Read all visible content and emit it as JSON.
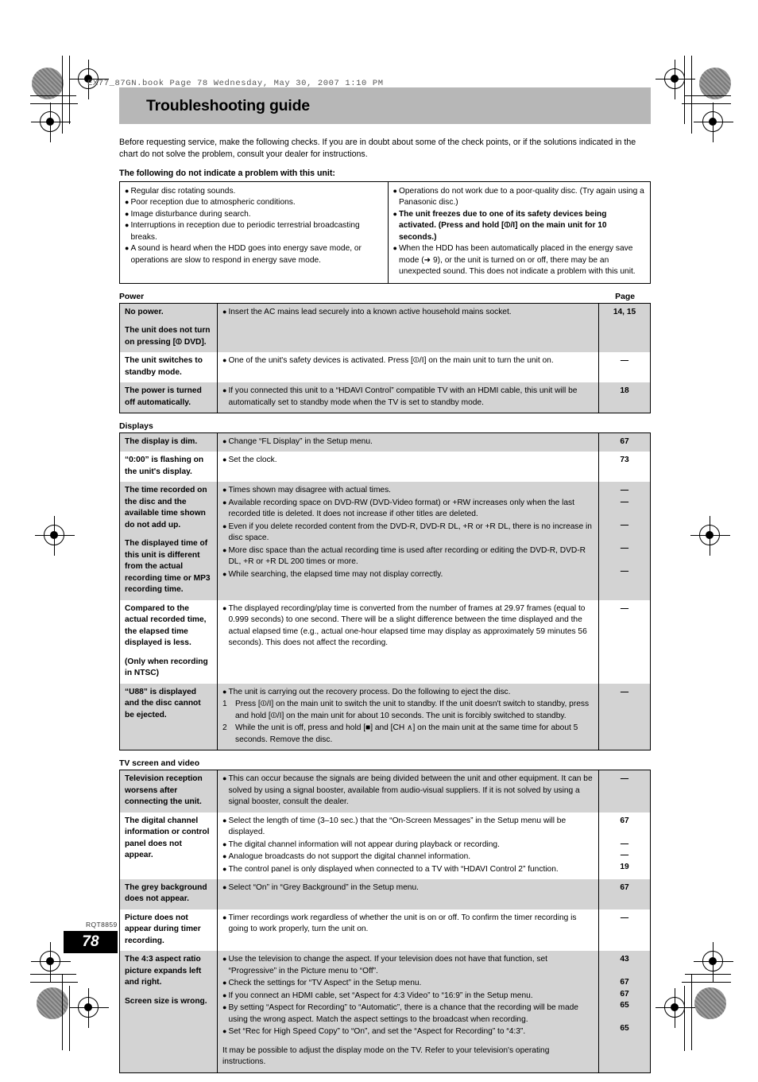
{
  "book_line": "EX77_87GN.book  Page 78  Wednesday, May 30, 2007  1:10 PM",
  "title": "Troubleshooting guide",
  "intro": "Before requesting service, make the following checks. If you are in doubt about some of the check points, or if the solutions indicated in the chart do not solve the problem, consult your dealer for instructions.",
  "intro_bold": "The following do not indicate a problem with this unit:",
  "notebox": {
    "left": [
      "Regular disc rotating sounds.",
      "Poor reception due to atmospheric conditions.",
      "Image disturbance during search.",
      "Interruptions in reception due to periodic terrestrial broadcasting breaks.",
      "A sound is heard when the HDD goes into energy save mode, or operations are slow to respond in energy save mode."
    ],
    "right": [
      {
        "bold": false,
        "text": "Operations do not work due to a poor-quality disc. (Try again using a Panasonic disc.)"
      },
      {
        "bold": true,
        "text": "The unit freezes due to one of its safety devices being activated. (Press and hold [⏼/I] on the main unit for 10 seconds.)"
      },
      {
        "bold": false,
        "text": "When the HDD has been automatically placed in the energy save mode (➜ 9), or the unit is turned on or off, there may be an unexpected sound. This does not indicate a problem with this unit."
      }
    ]
  },
  "page_label": "Page",
  "sections": [
    {
      "name": "Power",
      "rows": [
        {
          "shade": true,
          "symptom": [
            "No power.",
            "The unit does not turn on pressing [⏼ DVD]."
          ],
          "bullets": [
            "Insert the AC mains lead securely into a known active household mains socket."
          ],
          "pages": [
            "14, 15"
          ]
        },
        {
          "shade": false,
          "symptom": [
            "The unit switches to standby mode."
          ],
          "bullets": [
            "One of the unit's safety devices is activated. Press [⏼/I] on the main unit to turn the unit on."
          ],
          "pages": [
            "—"
          ]
        },
        {
          "shade": true,
          "symptom": [
            "The power is turned off automatically."
          ],
          "bullets": [
            "If you connected this unit to a “HDAVI Control” compatible TV with an HDMI cable, this unit will be automatically set to standby mode when the TV is set to standby mode."
          ],
          "pages": [
            "18"
          ]
        }
      ]
    },
    {
      "name": "Displays",
      "rows": [
        {
          "shade": true,
          "symptom": [
            "The display is dim."
          ],
          "bullets": [
            "Change “FL Display” in the Setup menu."
          ],
          "pages": [
            "67"
          ]
        },
        {
          "shade": false,
          "symptom": [
            "“0:00” is flashing on the unit's display."
          ],
          "bullets": [
            "Set the clock."
          ],
          "pages": [
            "73"
          ]
        },
        {
          "shade": true,
          "symptom": [
            "The time recorded on the disc and the available time shown do not add up.",
            "The displayed time of this unit is different from the actual recording time or MP3 recording time."
          ],
          "bullets": [
            "Times shown may disagree with actual times.",
            "Available recording space on DVD-RW (DVD-Video format) or +RW increases only when the last recorded title is deleted. It does not increase if other titles are deleted.",
            "Even if you delete recorded content from the DVD-R, DVD-R DL, +R or +R DL, there is no increase in disc space.",
            "More disc space than the actual recording time is used after recording or editing the DVD-R, DVD-R DL, +R or +R DL 200 times or more.",
            "While searching, the elapsed time may not display correctly."
          ],
          "pages": [
            "—",
            "—",
            "",
            "—",
            "",
            "—",
            "",
            "—"
          ]
        },
        {
          "shade": false,
          "symptom": [
            "Compared to the actual recorded time, the elapsed time displayed is less.",
            "(Only when recording in NTSC)"
          ],
          "bullets": [
            "The displayed recording/play time is converted from the number of frames at 29.97 frames (equal to 0.999 seconds) to one second. There will be a slight difference between the time displayed and the actual elapsed time (e.g., actual one-hour elapsed time may display as approximately 59 minutes 56 seconds). This does not affect the recording."
          ],
          "pages": [
            "—"
          ]
        },
        {
          "shade": true,
          "symptom": [
            "“U88” is displayed and the disc cannot be ejected."
          ],
          "bullets": [
            "The unit is carrying out the recovery process. Do the following to eject the disc."
          ],
          "numbered": [
            {
              "n": "1",
              "text": "Press [⏼/I] on the main unit to switch the unit to standby. If the unit doesn't switch to standby, press and hold [⏼/I] on the main unit for about 10 seconds. The unit is forcibly switched to standby."
            },
            {
              "n": "2",
              "text": "While the unit is off, press and hold [■] and [CH ∧] on the main unit at the same time for about 5 seconds. Remove the disc."
            }
          ],
          "pages": [
            "—"
          ]
        }
      ]
    },
    {
      "name": "TV screen and video",
      "rows": [
        {
          "shade": true,
          "symptom": [
            "Television reception worsens after connecting the unit."
          ],
          "bullets": [
            "This can occur because the signals are being divided between the unit and other equipment. It can be solved by using a signal booster, available from audio-visual suppliers. If it is not solved by using a signal booster, consult the dealer."
          ],
          "pages": [
            "—"
          ]
        },
        {
          "shade": false,
          "symptom": [
            "The digital channel information or control panel does not appear."
          ],
          "bullets": [
            "Select the length of time (3–10 sec.) that the “On-Screen Messages” in the Setup menu will be displayed.",
            "The digital channel information will not appear during playback or recording.",
            "Analogue broadcasts do not support the digital channel information.",
            "The control panel is only displayed when connected to a TV with “HDAVI Control 2” function."
          ],
          "pages": [
            "67",
            "",
            "—",
            "—",
            "19"
          ]
        },
        {
          "shade": true,
          "symptom": [
            "The grey background does not appear."
          ],
          "bullets": [
            "Select “On” in “Grey Background” in the Setup menu."
          ],
          "pages": [
            "67"
          ]
        },
        {
          "shade": false,
          "symptom": [
            "Picture does not appear during timer recording."
          ],
          "bullets": [
            "Timer recordings work regardless of whether the unit is on or off. To confirm the timer recording is going to work properly, turn the unit on."
          ],
          "pages": [
            "—"
          ]
        },
        {
          "shade": true,
          "symptom": [
            "The 4:3 aspect ratio picture expands left and right.",
            "Screen size is wrong."
          ],
          "bullets": [
            "Use the television to change the aspect. If your television does not have that function, set “Progressive” in the Picture menu to “Off”.",
            "Check the settings for “TV Aspect” in the Setup menu.",
            "If you connect an HDMI cable, set “Aspect for 4:3 Video” to “16:9” in the Setup menu.",
            "By setting “Aspect for Recording” to “Automatic”, there is a chance that the recording will be made using the wrong aspect. Match the aspect settings to the broadcast when recording.",
            "Set “Rec for High Speed Copy” to “On”, and set the “Aspect for Recording” to “4:3”."
          ],
          "trailing": "It may be possible to adjust the display mode on the TV. Refer to your television's operating instructions.",
          "pages": [
            "43",
            "",
            "67",
            "67",
            "65",
            "",
            "65"
          ]
        }
      ]
    }
  ],
  "footer": {
    "rqt": "RQT8859",
    "page_number": "78"
  }
}
